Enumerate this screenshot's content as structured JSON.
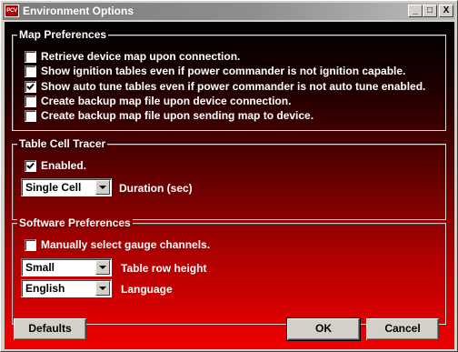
{
  "window": {
    "title": "Environment Options",
    "app_icon_text": "PCV",
    "controls": {
      "minimize": "_",
      "maximize": "□",
      "close": "X"
    }
  },
  "map_preferences": {
    "legend": "Map Preferences",
    "items": [
      {
        "label": "Retrieve device map upon connection.",
        "checked": false
      },
      {
        "label": "Show ignition tables even if power commander is not ignition capable.",
        "checked": false
      },
      {
        "label": "Show auto tune tables even if power commander is not auto tune enabled.",
        "checked": true
      },
      {
        "label": "Create backup map file upon device connection.",
        "checked": false
      },
      {
        "label": "Create backup map file upon sending map to device.",
        "checked": false
      }
    ]
  },
  "table_cell_tracer": {
    "legend": "Table Cell Tracer",
    "enabled_label": "Enabled.",
    "enabled_checked": true,
    "duration_value": "Single Cell",
    "duration_label": "Duration (sec)"
  },
  "software_preferences": {
    "legend": "Software Preferences",
    "manual_gauge_label": "Manually select gauge channels.",
    "manual_gauge_checked": false,
    "row_height_value": "Small",
    "row_height_label": "Table row height",
    "language_value": "English",
    "language_label": "Language"
  },
  "buttons": {
    "defaults": "Defaults",
    "ok": "OK",
    "cancel": "Cancel"
  }
}
